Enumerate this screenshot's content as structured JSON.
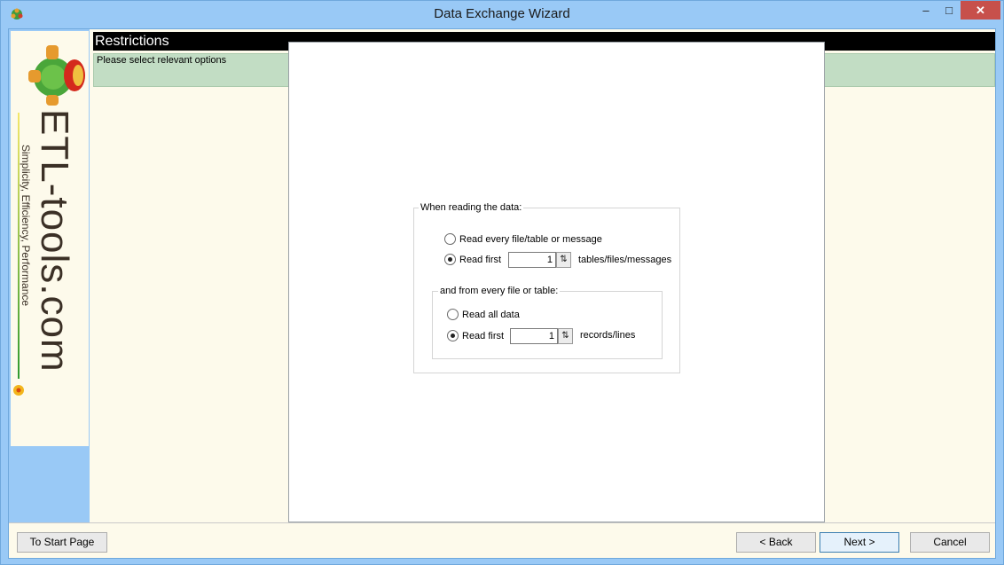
{
  "window": {
    "title": "Data Exchange Wizard",
    "minimize_glyph": "–",
    "maximize_glyph": "□",
    "close_glyph": "✕"
  },
  "sidebar": {
    "brand": "ETL-tools.com",
    "tagline": "Simplicity, Efficiency, Performance"
  },
  "header": {
    "title": "Restrictions",
    "subtitle": "Please select relevant options"
  },
  "options": {
    "reading_group": {
      "legend": "When reading the data:",
      "radio_every_label": "Read every file/table or message",
      "radio_first_label": "Read first",
      "first_value": "1",
      "first_unit": "tables/files/messages",
      "selected": "first"
    },
    "records_group": {
      "legend": "and from every file or table:",
      "radio_all_label": "Read all data",
      "radio_first_label": "Read first",
      "first_value": "1",
      "first_unit": "records/lines",
      "selected": "first"
    },
    "spin_glyph": "⇅"
  },
  "footer": {
    "start_label": "To Start Page",
    "back_label": "< Back",
    "next_label": "Next >",
    "cancel_label": "Cancel"
  },
  "colors": {
    "title_bar": "#99c9f6",
    "close_button": "#c7504b",
    "header_bar": "#000000",
    "subheader": "#c2ddc4",
    "panel_bg": "#fdfaeb"
  }
}
